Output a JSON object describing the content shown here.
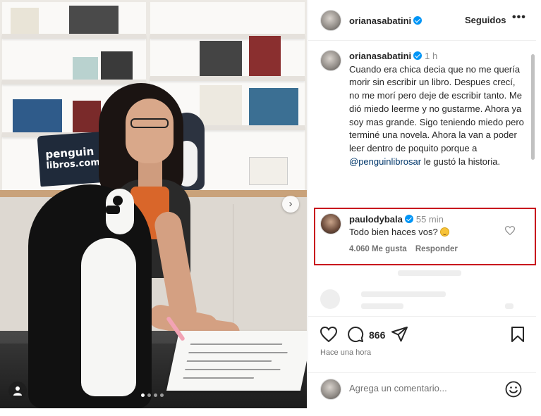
{
  "post": {
    "author": {
      "username": "orianasabatini",
      "verified": true
    },
    "follow_status": "Seguidos",
    "more_label": "•••",
    "caption": {
      "username": "orianasabatini",
      "time": "1 h",
      "text_before_mention": "Cuando era chica decia que no me quería morir sin escribir un libro. Despues crecí, no me morí pero deje de escribir tanto. Me dió miedo leerme y no gustarme. Ahora ya soy mas grande. Sigo teniendo miedo pero terminé una novela. Ahora la van a poder leer dentro de poquito porque a ",
      "mention": "@penguinlibrosar",
      "text_after_mention": " le gustó la historia."
    },
    "highlighted_comment": {
      "username": "paulodybala",
      "verified": true,
      "time": "55 min",
      "text": "Todo bien haces vos?",
      "likes": "4.060 Me gusta",
      "reply_label": "Responder"
    },
    "comment_count": "866",
    "posted_time": "Hace una hora",
    "comment_placeholder": "Agrega un comentario...",
    "photo": {
      "sign_text_line1": "penguin",
      "sign_text_line2": "libros.com",
      "carousel_dots": 4,
      "active_dot": 1
    }
  },
  "icons": {
    "like": "heart-icon",
    "comment": "speech-bubble-icon",
    "share": "paper-plane-icon",
    "save": "bookmark-icon",
    "emoji": "smiley-icon",
    "tag": "user-tag-icon",
    "next": "chevron-right-icon"
  },
  "colors": {
    "verified": "#0095f6",
    "highlight_border": "#c8151d",
    "mention": "#00376b"
  }
}
